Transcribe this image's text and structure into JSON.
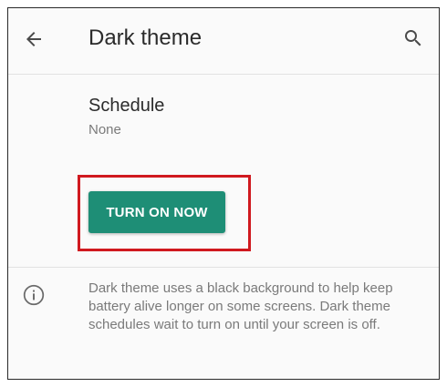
{
  "app_bar": {
    "title": "Dark theme",
    "back_icon": "arrow-back-icon",
    "search_icon": "search-icon"
  },
  "schedule": {
    "label": "Schedule",
    "value": "None"
  },
  "action": {
    "turn_on_label": "TURN ON NOW",
    "accent_color": "#1e8e76",
    "highlight_color": "#d0191f"
  },
  "info": {
    "icon": "info-icon",
    "text": "Dark theme uses a black background to help keep battery alive longer on some screens. Dark theme schedules wait to turn on until your screen is off."
  }
}
